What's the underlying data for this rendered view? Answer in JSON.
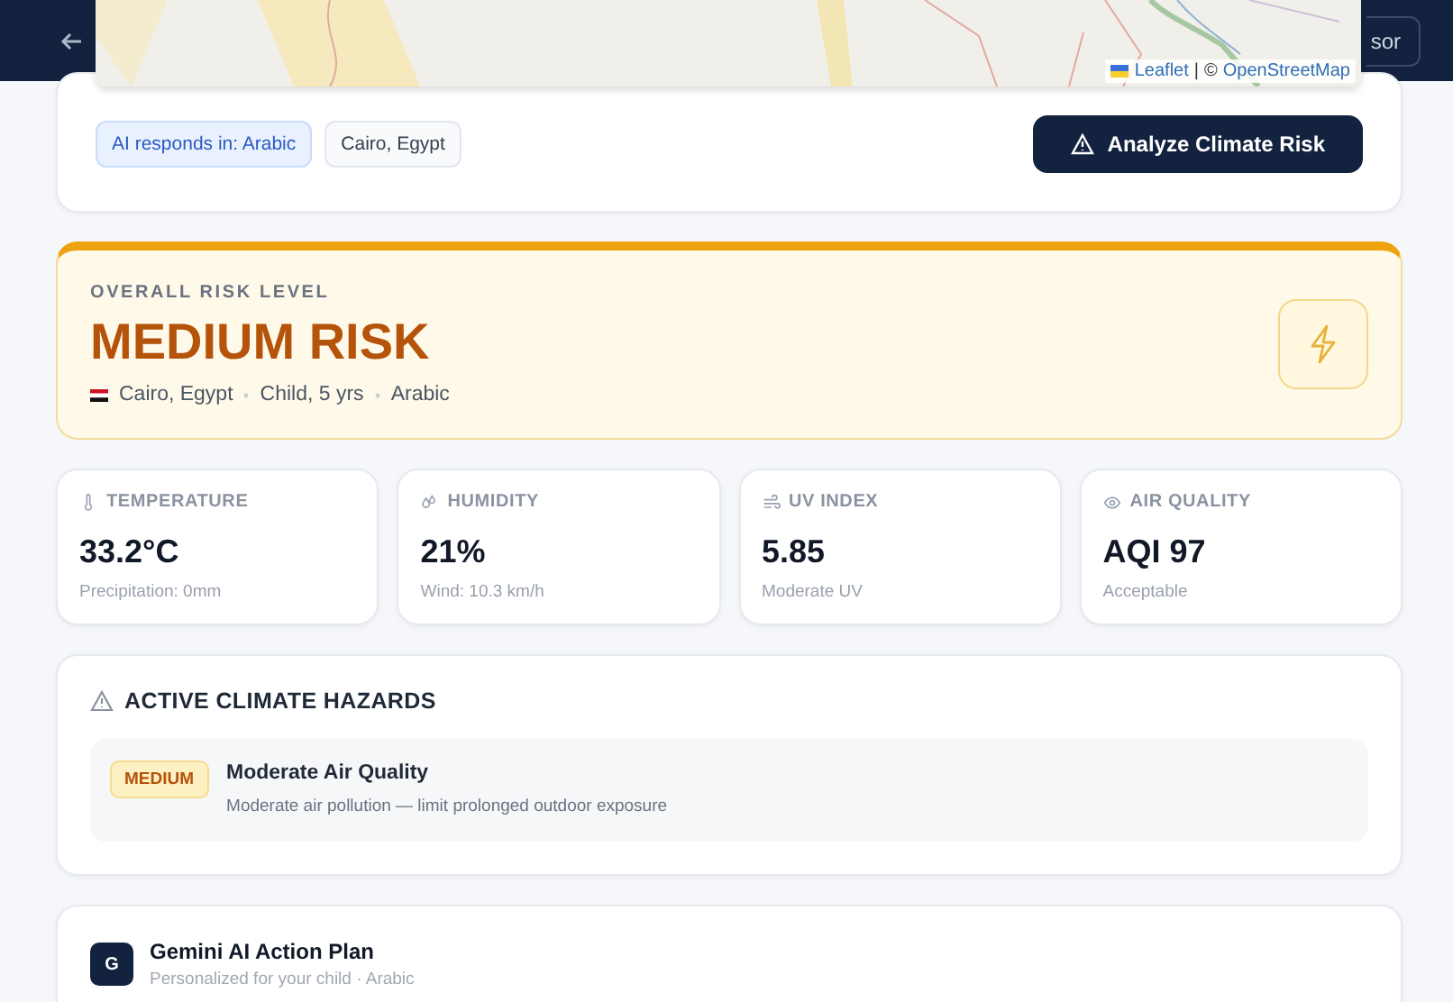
{
  "header": {
    "partial_button": "sor"
  },
  "map": {
    "attribution": {
      "leaflet": "Leaflet",
      "separator": "|",
      "osm_prefix": "©",
      "osm": "OpenStreetMap"
    }
  },
  "controls": {
    "chips": [
      {
        "label": "AI responds in: Arabic",
        "kind": "accent"
      },
      {
        "label": "Cairo, Egypt",
        "kind": "plain"
      }
    ],
    "analyze_button": "Analyze Climate Risk"
  },
  "risk": {
    "eyebrow": "OVERALL RISK LEVEL",
    "level": "MEDIUM RISK",
    "color": "#b45309",
    "meta": [
      "Cairo, Egypt",
      "Child, 5 yrs",
      "Arabic"
    ]
  },
  "metrics": [
    {
      "kind": "temperature",
      "label": "TEMPERATURE",
      "value": "33.2°C",
      "sub": "Precipitation: 0mm"
    },
    {
      "kind": "humidity",
      "label": "HUMIDITY",
      "value": "21%",
      "sub": "Wind: 10.3 km/h"
    },
    {
      "kind": "uv",
      "label": "UV INDEX",
      "value": "5.85",
      "sub": "Moderate UV"
    },
    {
      "kind": "air",
      "label": "AIR QUALITY",
      "value": "AQI 97",
      "sub": "Acceptable"
    }
  ],
  "hazards": {
    "title": "ACTIVE CLIMATE HAZARDS",
    "items": [
      {
        "severity": "MEDIUM",
        "title": "Moderate Air Quality",
        "description": "Moderate air pollution — limit prolonged outdoor exposure"
      }
    ]
  },
  "plan": {
    "badge": "G",
    "title": "Gemini AI Action Plan",
    "subtitle": "Personalized for your child · Arabic"
  }
}
